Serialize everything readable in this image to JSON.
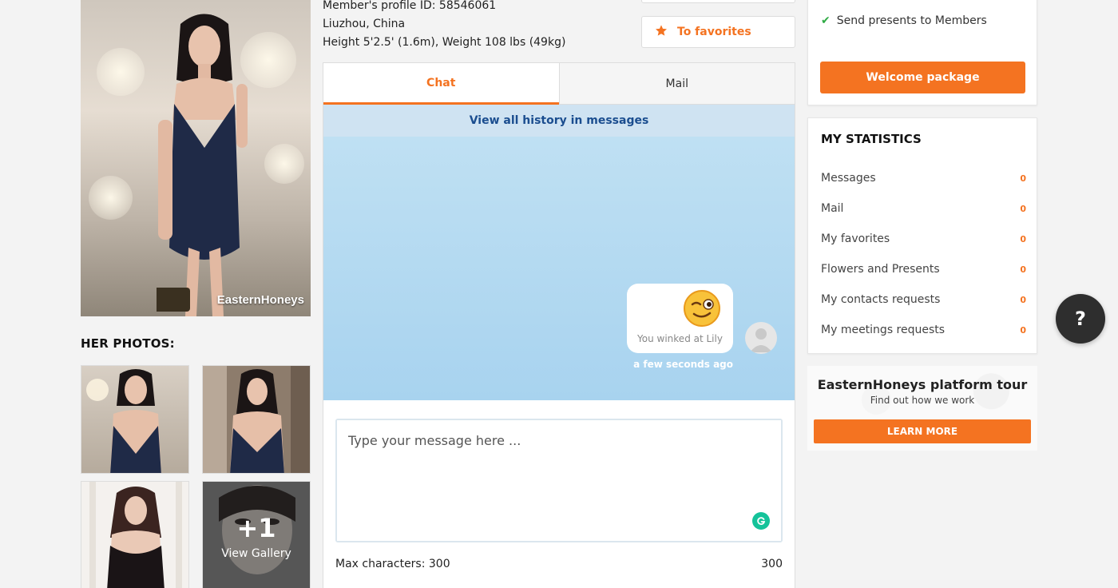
{
  "profile": {
    "id_line": "Member's profile ID: 58546061",
    "location": "Liuzhou, China",
    "stats": "Height 5'2.5' (1.6m), Weight 108 lbs (49kg)"
  },
  "main_photo": {
    "watermark": "EasternHoneys"
  },
  "photos": {
    "title": "HER PHOTOS:",
    "gallery_count": "+1",
    "gallery_label": "View Gallery"
  },
  "favorites": {
    "label": "To favorites",
    "icon": "star-icon"
  },
  "tabs": [
    {
      "label": "Chat",
      "active": true
    },
    {
      "label": "Mail",
      "active": false
    }
  ],
  "chat": {
    "history_link": "View all history in messages",
    "message_text": "You winked at Lily",
    "message_time": "a few seconds ago",
    "input_placeholder": "Type your message here ...",
    "max_chars_label": "Max characters: 300",
    "char_count": "300"
  },
  "perks": {
    "item": "Send presents to Members",
    "welcome_button": "Welcome package"
  },
  "statistics": {
    "title": "MY STATISTICS",
    "items": [
      {
        "label": "Messages",
        "count": "0"
      },
      {
        "label": "Mail",
        "count": "0"
      },
      {
        "label": "My favorites",
        "count": "0"
      },
      {
        "label": "Flowers and Presents",
        "count": "0"
      },
      {
        "label": "My contacts requests",
        "count": "0"
      },
      {
        "label": "My meetings requests",
        "count": "0"
      }
    ]
  },
  "tour": {
    "title": "EasternHoneys platform tour",
    "subtitle": "Find out how we work",
    "button": "LEARN MORE"
  },
  "help": {
    "label": "?"
  },
  "colors": {
    "accent": "#f47321",
    "link": "#1a4d8f",
    "chat_bg": "#b3d9f1",
    "check": "#2eaa44"
  }
}
